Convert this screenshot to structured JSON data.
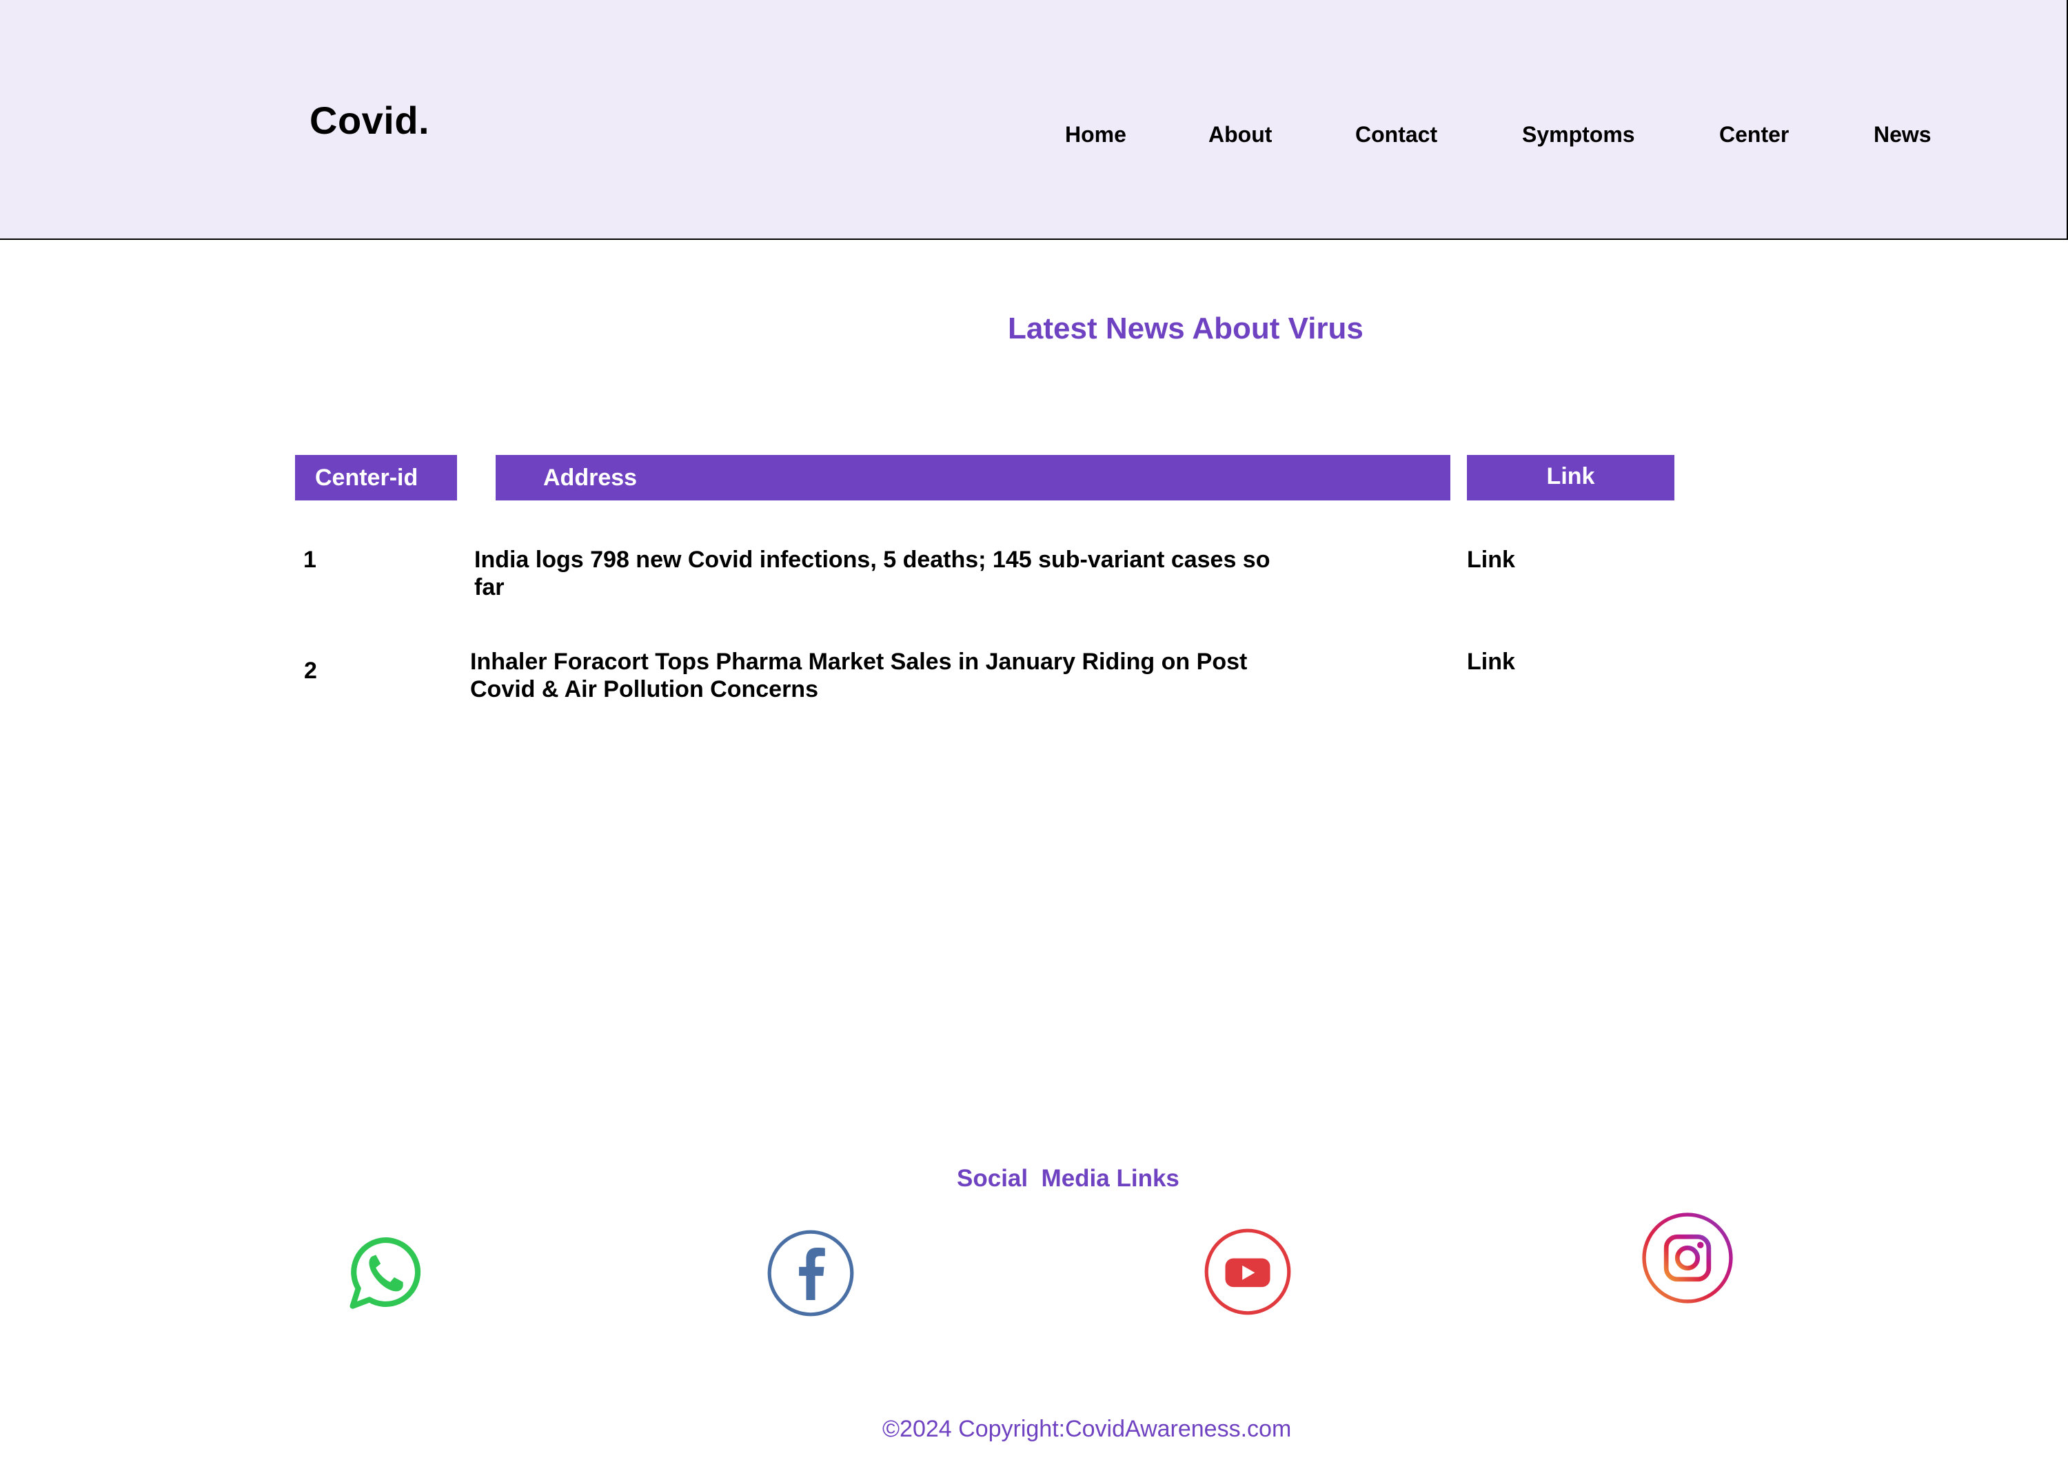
{
  "header": {
    "brand": "Covid.",
    "nav": [
      "Home",
      "About",
      "Contact",
      "Symptoms",
      "Center",
      "News"
    ]
  },
  "main": {
    "title": "Latest News About Virus",
    "table": {
      "headers": [
        "Center-id",
        "Address",
        "Link"
      ],
      "rows": [
        {
          "id": "1",
          "address": "India logs 798 new Covid infections, 5 deaths; 145 sub-variant cases so far",
          "link": "Link"
        },
        {
          "id": "2",
          "address": "Inhaler Foracort Tops Pharma Market Sales in January Riding on Post Covid & Air Pollution Concerns",
          "link": "Link"
        }
      ]
    }
  },
  "social": {
    "title": "Social  Media Links",
    "icons": [
      "whatsapp-icon",
      "facebook-icon",
      "youtube-icon",
      "instagram-icon"
    ]
  },
  "footer": {
    "copyright": "©2024 Copyright:CovidAwareness.com"
  },
  "colors": {
    "accent": "#6f42c1",
    "header_bg": "#efebf8",
    "whatsapp": "#2fc653",
    "facebook": "#4a6fa5",
    "youtube": "#e0393e",
    "instagram": "#c13584"
  }
}
